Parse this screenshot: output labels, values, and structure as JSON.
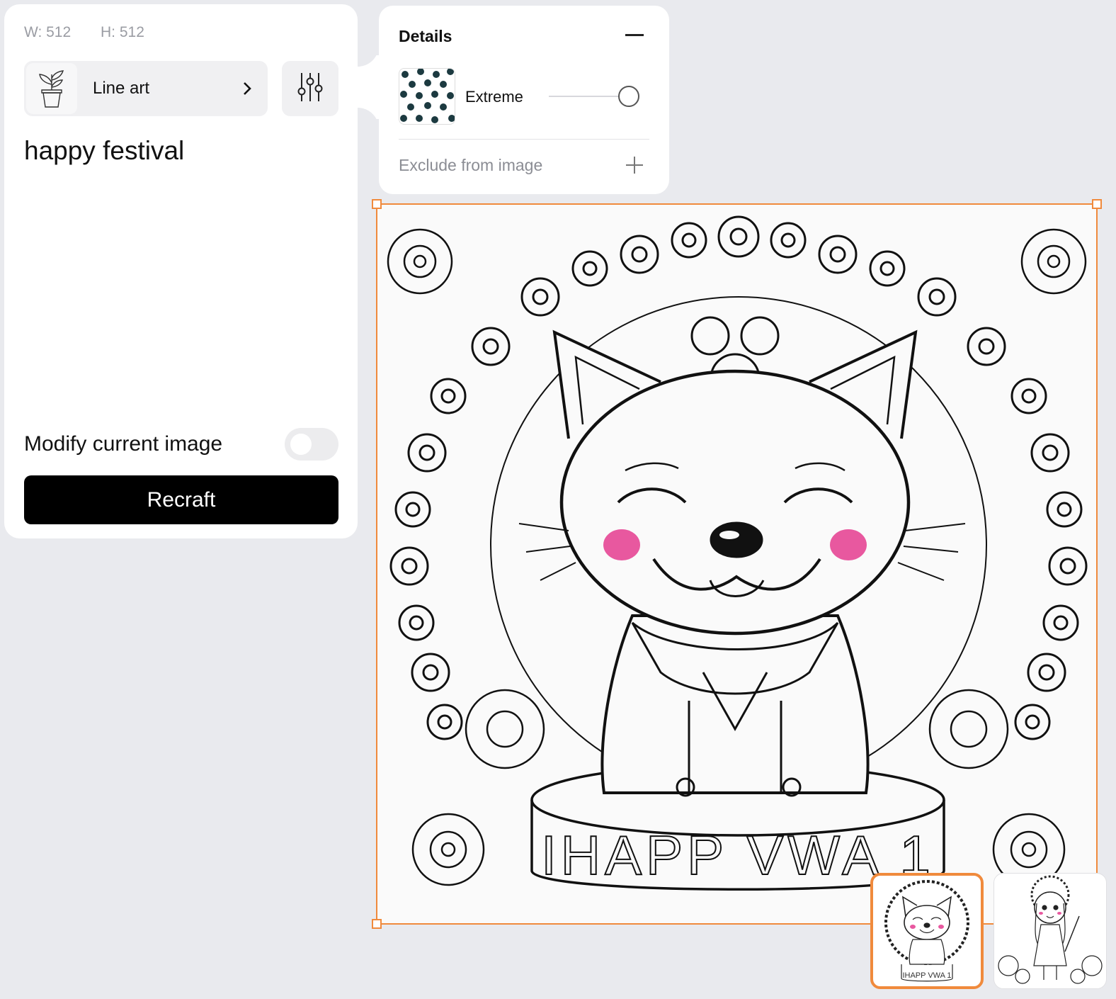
{
  "dimensions": {
    "width_label": "W: 512",
    "height_label": "H: 512"
  },
  "style": {
    "name": "Line art",
    "icon": "potted-plant-icon"
  },
  "prompt": {
    "text": "happy festival"
  },
  "modify": {
    "label": "Modify current image",
    "enabled": false
  },
  "actions": {
    "recraft_label": "Recraft"
  },
  "details": {
    "title": "Details",
    "level_label": "Extreme",
    "slider_level": 1.0,
    "exclude_label": "Exclude from image"
  },
  "canvas": {
    "banner_text": "IHAPP VWA 1",
    "selection_color": "#f08a3c",
    "blush_color": "#e8589f"
  },
  "thumbnails": [
    {
      "selected": true,
      "banner_text": "IHAPP VWA 1"
    },
    {
      "selected": false
    }
  ]
}
